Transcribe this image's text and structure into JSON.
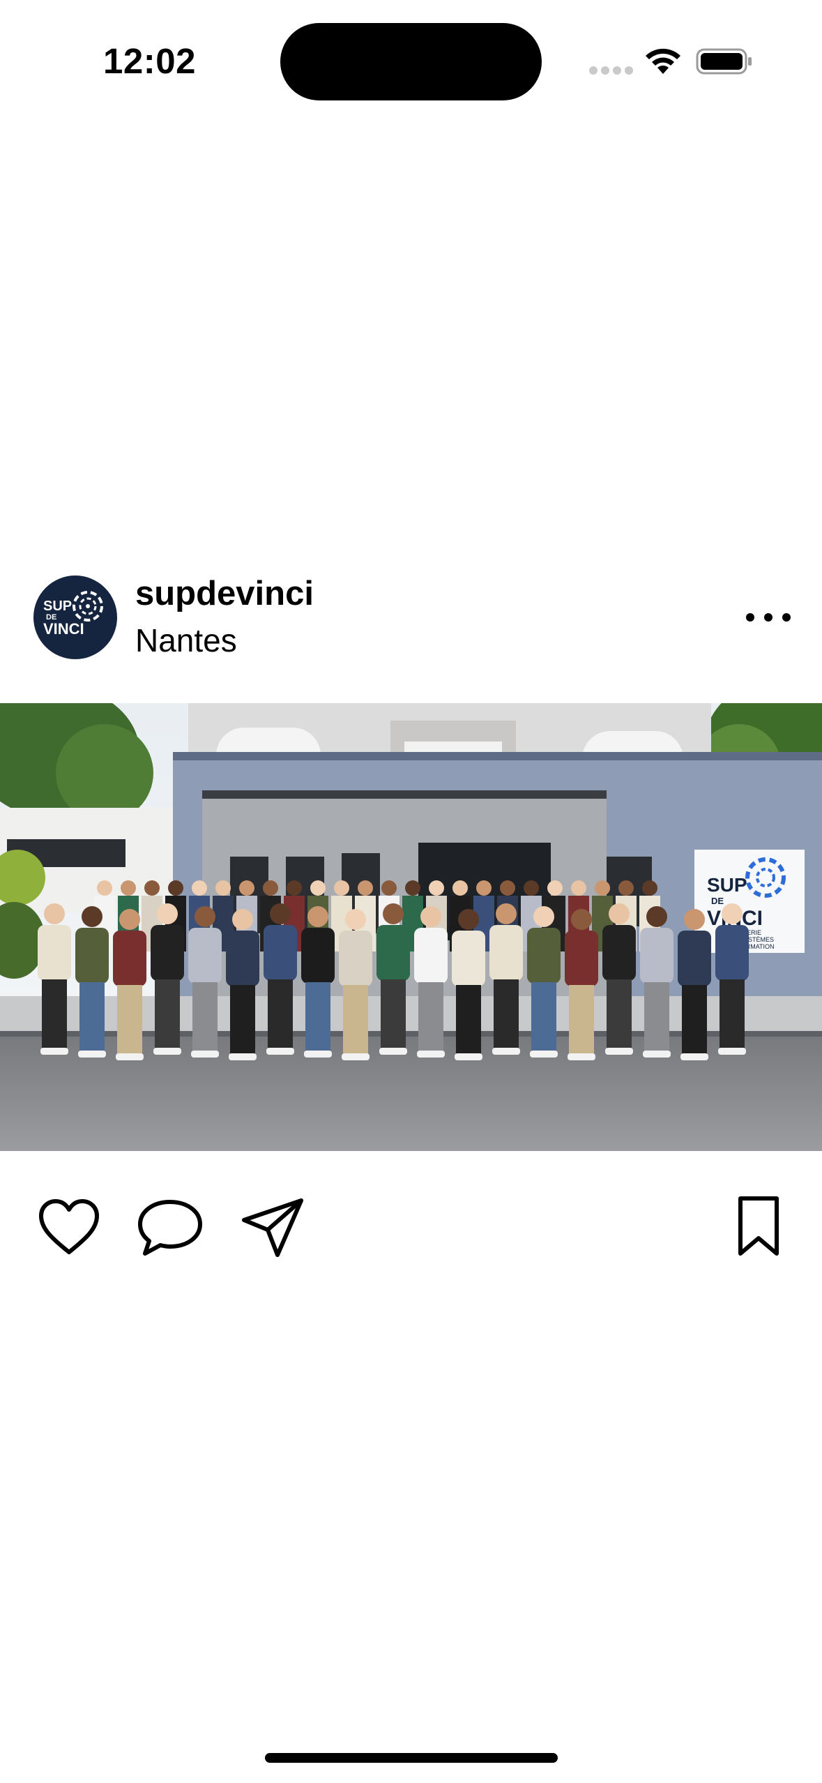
{
  "status_bar": {
    "time": "12:02",
    "signal_icon": "cellular-signal-icon",
    "wifi_icon": "wifi-icon",
    "battery_icon": "battery-icon"
  },
  "post": {
    "username": "supdevinci",
    "location": "Nantes",
    "avatar": {
      "line1": "SUP",
      "line2": "DE",
      "line3": "VINCI",
      "background_color": "#15253f",
      "accent_color": "#2d6cd9"
    },
    "more_icon": "more-options-icon",
    "photo": {
      "sign_line1": "SUP",
      "sign_line2": "DE",
      "sign_line3": "VINCI",
      "sign_subtitle_1": "INGÉNIERIE",
      "sign_subtitle_2": "DES SYSTÈMES",
      "sign_subtitle_3": "D'INFORMATION"
    },
    "actions": {
      "like_icon": "heart-icon",
      "comment_icon": "comment-bubble-icon",
      "share_icon": "paper-plane-icon",
      "save_icon": "bookmark-icon"
    }
  }
}
